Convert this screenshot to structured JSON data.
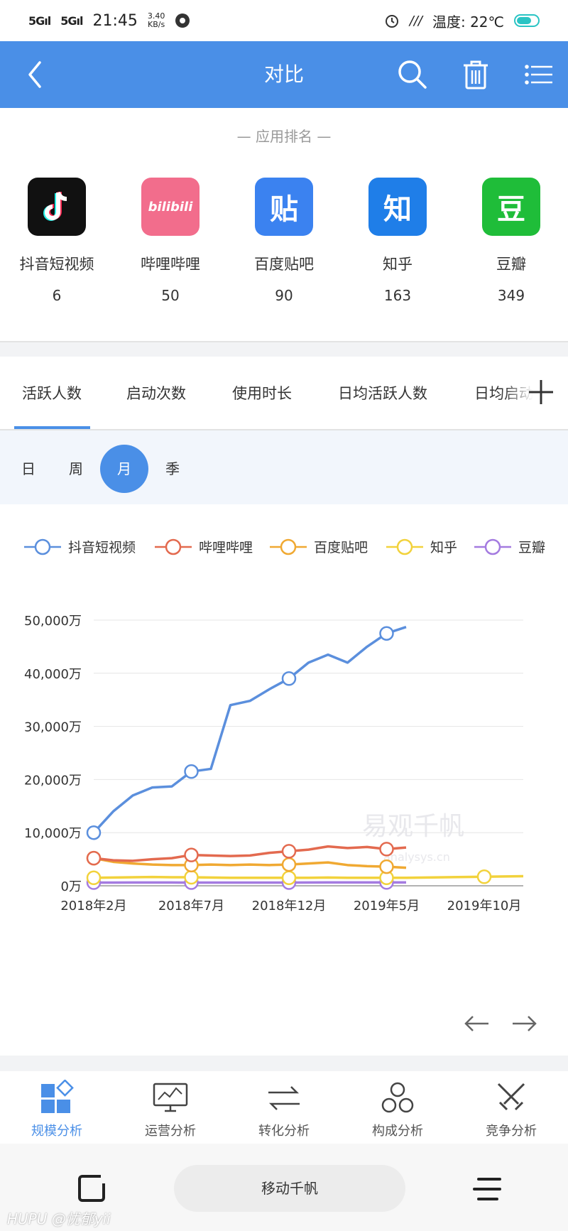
{
  "status_bar": {
    "signal1": "5G",
    "signal2": "5G",
    "time": "21:45",
    "speed_value": "3.40",
    "speed_unit": "KB/s",
    "temperature": "温度: 22℃"
  },
  "header": {
    "title": "对比"
  },
  "ranking": {
    "title": "— 应用排名 —",
    "apps": [
      {
        "name": "抖音短视频",
        "rank": "6",
        "icon": "douyin-icon",
        "color": "#111111"
      },
      {
        "name": "哔哩哔哩",
        "rank": "50",
        "icon": "bilibili-icon",
        "color": "#f26d8c",
        "logo_text": "bilibili"
      },
      {
        "name": "百度贴吧",
        "rank": "90",
        "icon": "tieba-icon",
        "color": "#3b82f0",
        "logo_text": "贴"
      },
      {
        "name": "知乎",
        "rank": "163",
        "icon": "zhihu-icon",
        "color": "#1f7ee8",
        "logo_text": "知"
      },
      {
        "name": "豆瓣",
        "rank": "349",
        "icon": "douban-icon",
        "color": "#1fbd39",
        "logo_text": "豆"
      }
    ]
  },
  "tabs": [
    {
      "label": "活跃人数",
      "active": true
    },
    {
      "label": "启动次数"
    },
    {
      "label": "使用时长"
    },
    {
      "label": "日均活跃人数"
    },
    {
      "label": "日均启动"
    }
  ],
  "periods": [
    {
      "label": "日"
    },
    {
      "label": "周"
    },
    {
      "label": "月",
      "active": true
    },
    {
      "label": "季"
    }
  ],
  "chart_data": {
    "type": "line",
    "y_unit": "万",
    "ylim": [
      0,
      50000
    ],
    "y_ticks": [
      "50,000万",
      "40,000万",
      "30,000万",
      "20,000万",
      "10,000万",
      "0万"
    ],
    "x_ticks": [
      "2018年2月",
      "2018年7月",
      "2018年12月",
      "2019年5月",
      "2019年10月"
    ],
    "x_months": [
      "2018-02",
      "2018-03",
      "2018-04",
      "2018-05",
      "2018-06",
      "2018-07",
      "2018-08",
      "2018-09",
      "2018-10",
      "2018-11",
      "2018-12",
      "2019-01",
      "2019-02",
      "2019-03",
      "2019-04",
      "2019-05",
      "2019-06",
      "2019-07",
      "2019-08",
      "2019-09",
      "2019-10",
      "2019-11",
      "2019-12"
    ],
    "series": [
      {
        "name": "抖音短视频",
        "color": "#5b8fdd",
        "values": [
          10000,
          14000,
          17000,
          18500,
          18700,
          21500,
          22000,
          34000,
          34800,
          37000,
          39000,
          42000,
          43500,
          42000,
          45000,
          47500,
          48700
        ]
      },
      {
        "name": "哔哩哔哩",
        "color": "#e36a4f",
        "values": [
          5200,
          4800,
          4700,
          5000,
          5200,
          5800,
          5700,
          5600,
          5700,
          6200,
          6500,
          6800,
          7400,
          7100,
          7300,
          6900,
          7200
        ]
      },
      {
        "name": "百度贴吧",
        "color": "#f0a932",
        "values": [
          5200,
          4500,
          4200,
          4000,
          3900,
          3900,
          4000,
          3900,
          4000,
          3900,
          4000,
          4200,
          4400,
          3900,
          3700,
          3600,
          3400
        ]
      },
      {
        "name": "知乎",
        "color": "#f2d23c",
        "values": [
          1500,
          1550,
          1600,
          1650,
          1600,
          1600,
          1550,
          1500,
          1500,
          1500,
          1500,
          1500,
          1550,
          1500,
          1500,
          1500,
          1500,
          1550,
          1600,
          1650,
          1700,
          1750,
          1800
        ]
      },
      {
        "name": "豆瓣",
        "color": "#a47be0",
        "values": [
          600,
          600,
          620,
          620,
          610,
          600,
          600,
          600,
          600,
          600,
          600,
          620,
          640,
          640,
          640,
          640,
          640
        ]
      }
    ],
    "markers_at": [
      0,
      5,
      10,
      15
    ],
    "zhihu_extra_marker": 20,
    "watermark": "易观千帆",
    "watermark_sub": "analysys.cn",
    "grid": true,
    "legend_position": "top"
  },
  "bottom_nav": [
    {
      "label": "规模分析",
      "icon": "scale-analysis-icon",
      "active": true
    },
    {
      "label": "运营分析",
      "icon": "operation-analysis-icon"
    },
    {
      "label": "转化分析",
      "icon": "conversion-analysis-icon"
    },
    {
      "label": "构成分析",
      "icon": "composition-analysis-icon"
    },
    {
      "label": "竞争分析",
      "icon": "competition-analysis-icon"
    }
  ],
  "system_nav": {
    "center_label": "移动千帆"
  },
  "watermark_credit": "HUPU @忧郁yii"
}
